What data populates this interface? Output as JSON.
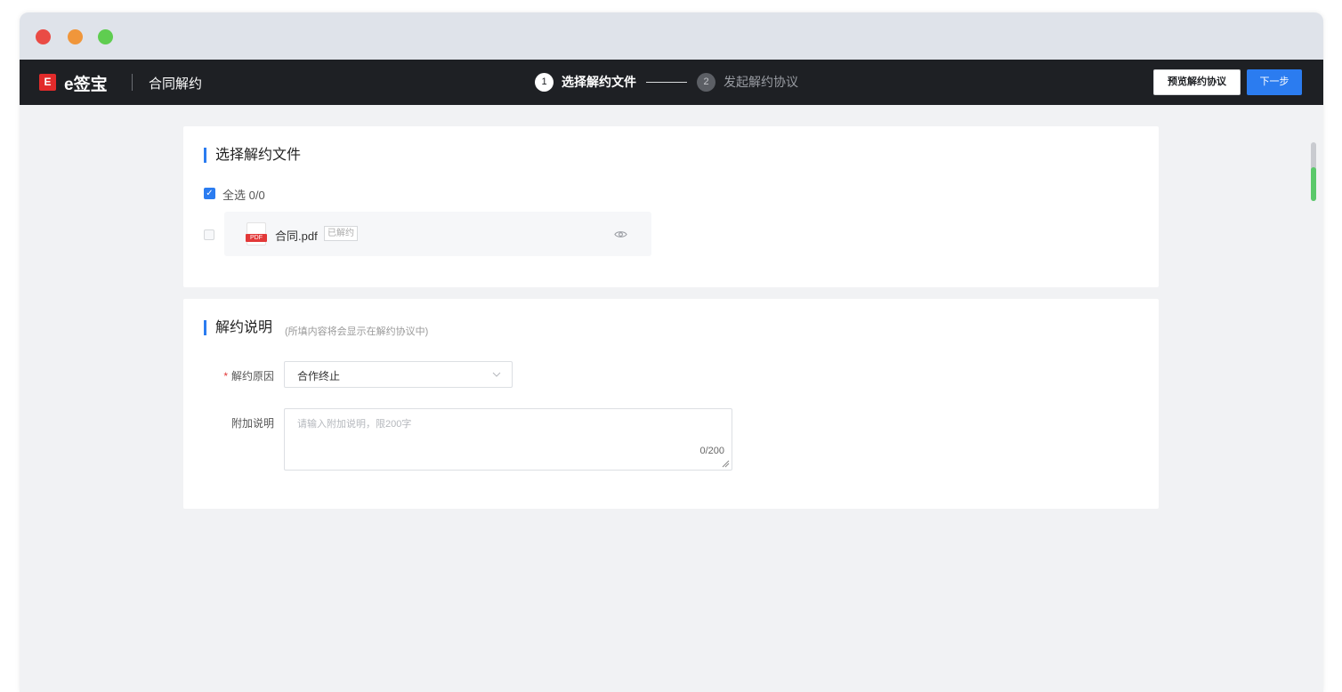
{
  "header": {
    "logo_glyph": "E",
    "brand": "e签宝",
    "module": "合同解约",
    "steps": [
      {
        "num": "1",
        "label": "选择解约文件"
      },
      {
        "num": "2",
        "label": "发起解约协议"
      }
    ],
    "preview_button": "预览解约协议",
    "next_button": "下一步"
  },
  "file_section": {
    "title": "选择解约文件",
    "select_all": "全选 0/0",
    "file": {
      "icon_text": "PDF",
      "name": "合同.pdf",
      "badge": "已解约"
    }
  },
  "reason_section": {
    "title": "解约说明",
    "hint": "(所填内容将会显示在解约协议中)",
    "reason_label": "解约原因",
    "required_mark": "*",
    "reason_value": "合作终止",
    "note_label": "附加说明",
    "note_placeholder": "请输入附加说明，限200字",
    "note_count": "0/200"
  },
  "colors": {
    "accent": "#2b7cf0",
    "appbar": "#1e2024",
    "brand_red": "#e22b2b"
  }
}
